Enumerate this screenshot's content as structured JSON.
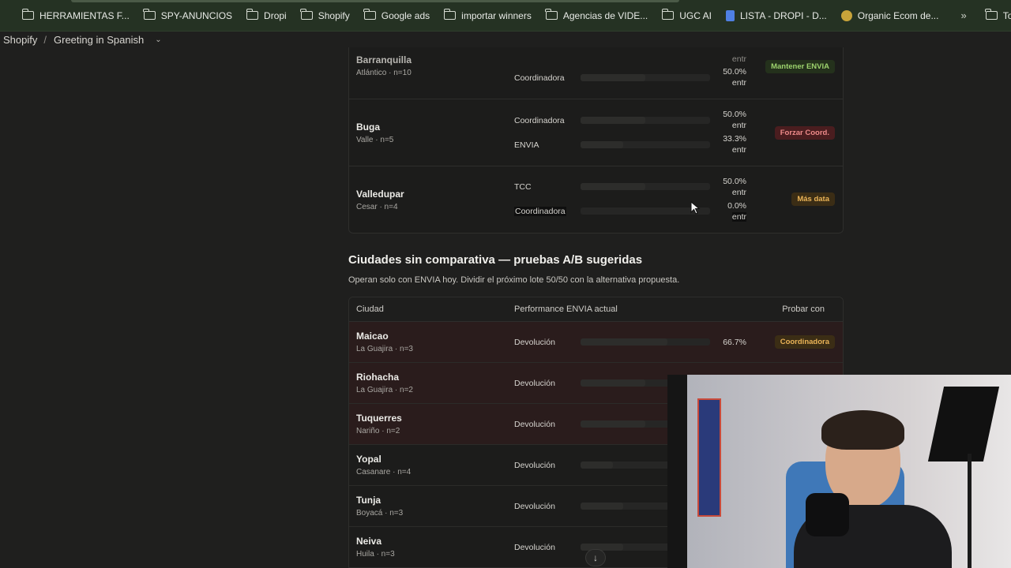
{
  "bookmarks": [
    {
      "label": "HERRAMIENTAS F...",
      "icon": "folder-icon"
    },
    {
      "label": "SPY-ANUNCIOS",
      "icon": "folder-icon"
    },
    {
      "label": "Dropi",
      "icon": "folder-icon"
    },
    {
      "label": "Shopify",
      "icon": "folder-icon"
    },
    {
      "label": "Google ads",
      "icon": "folder-icon"
    },
    {
      "label": "importar winners",
      "icon": "folder-icon"
    },
    {
      "label": "Agencias de VIDE...",
      "icon": "folder-icon"
    },
    {
      "label": "UGC AI",
      "icon": "folder-icon"
    },
    {
      "label": "LISTA - DROPI - D...",
      "icon": "doc-icon"
    },
    {
      "label": "Organic Ecom de...",
      "icon": "logo-icon"
    }
  ],
  "bookmarks_more": "»",
  "bookmarks_all": "Todos los marc",
  "tabrow": {
    "app": "Shopify",
    "separator": "/",
    "title": "Greeting in Spanish",
    "chevron": "⌄"
  },
  "top_table": {
    "rows": [
      {
        "city": "Barranquilla",
        "sub": "Atlántico · n=10",
        "items": [
          {
            "label": "",
            "pct": "entr"
          },
          {
            "label": "Coordinadora",
            "pct": "50.0%",
            "unit": "entr"
          }
        ],
        "badge": "Mantener ENVIA"
      },
      {
        "city": "Buga",
        "sub": "Valle · n=5",
        "items": [
          {
            "label": "Coordinadora",
            "pct": "50.0%",
            "unit": "entr"
          },
          {
            "label": "ENVIA",
            "pct": "33.3%",
            "unit": "entr"
          }
        ],
        "badge": "Forzar Coord."
      },
      {
        "city": "Valledupar",
        "sub": "Cesar · n=4",
        "items": [
          {
            "label": "TCC",
            "pct": "50.0%",
            "unit": "entr"
          },
          {
            "label": "Coordinadora",
            "pct": "0.0%",
            "unit": "entr"
          }
        ],
        "badge": "Más data"
      }
    ]
  },
  "section": {
    "title": "Ciudades sin comparativa — pruebas A/B sugeridas",
    "desc": "Operan solo con ENVIA hoy. Dividir el próximo lote 50/50 con la alternativa propuesta."
  },
  "ab_table": {
    "headers": {
      "city": "Ciudad",
      "perf": "Performance ENVIA actual",
      "try": "Probar con"
    },
    "rows": [
      {
        "city": "Maicao",
        "sub": "La Guajira · n=3",
        "metric": "Devolución",
        "pct": "66.7%",
        "badge": "Coordinadora"
      },
      {
        "city": "Riohacha",
        "sub": "La Guajira · n=2",
        "metric": "Devolución"
      },
      {
        "city": "Tuquerres",
        "sub": "Nariño · n=2",
        "metric": "Devolución"
      },
      {
        "city": "Yopal",
        "sub": "Casanare · n=4",
        "metric": "Devolución"
      },
      {
        "city": "Tunja",
        "sub": "Boyacá · n=3",
        "metric": "Devolución"
      },
      {
        "city": "Neiva",
        "sub": "Huila · n=3",
        "metric": "Devolución"
      }
    ]
  },
  "scroll_button": "↓"
}
